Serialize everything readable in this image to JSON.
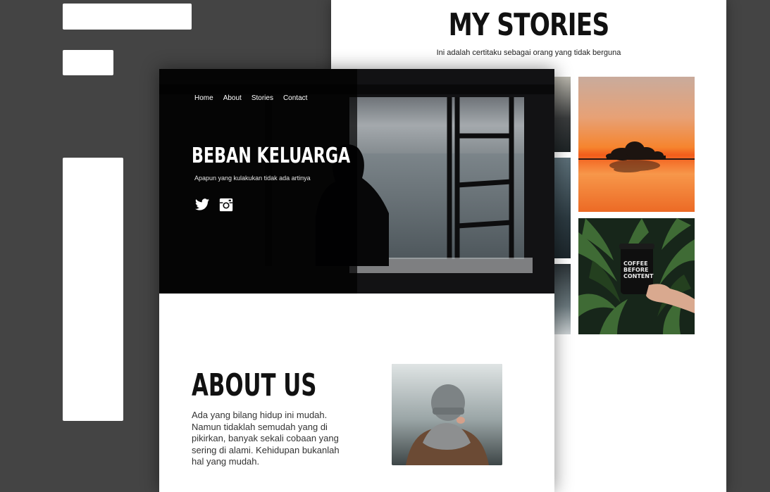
{
  "stories": {
    "title": "MY STORIES",
    "subtitle": "Ini adalah certitaku sebagai orang yang tidak berguna"
  },
  "hero": {
    "nav": [
      "Home",
      "About",
      "Stories",
      "Contact"
    ],
    "title": "BEBAN KELUARGA",
    "subtitle": "Apapun yang kulakukan tidak ada artinya",
    "social": [
      "twitter-icon",
      "instagram-icon"
    ]
  },
  "about": {
    "title": "ABOUT US",
    "text": "Ada yang bilang hidup ini mudah. Namun tidaklah semudah yang di pikirkan, banyak sekali cobaan yang sering di alami. Kehidupan bukanlah hal yang mudah."
  },
  "photos": {
    "coffee_cup_text": "COFFEE BEFORE CONTENT"
  },
  "colors": {
    "background": "#444444",
    "card": "#ffffff",
    "hero_overlay": "#000000",
    "heading": "#111111"
  }
}
